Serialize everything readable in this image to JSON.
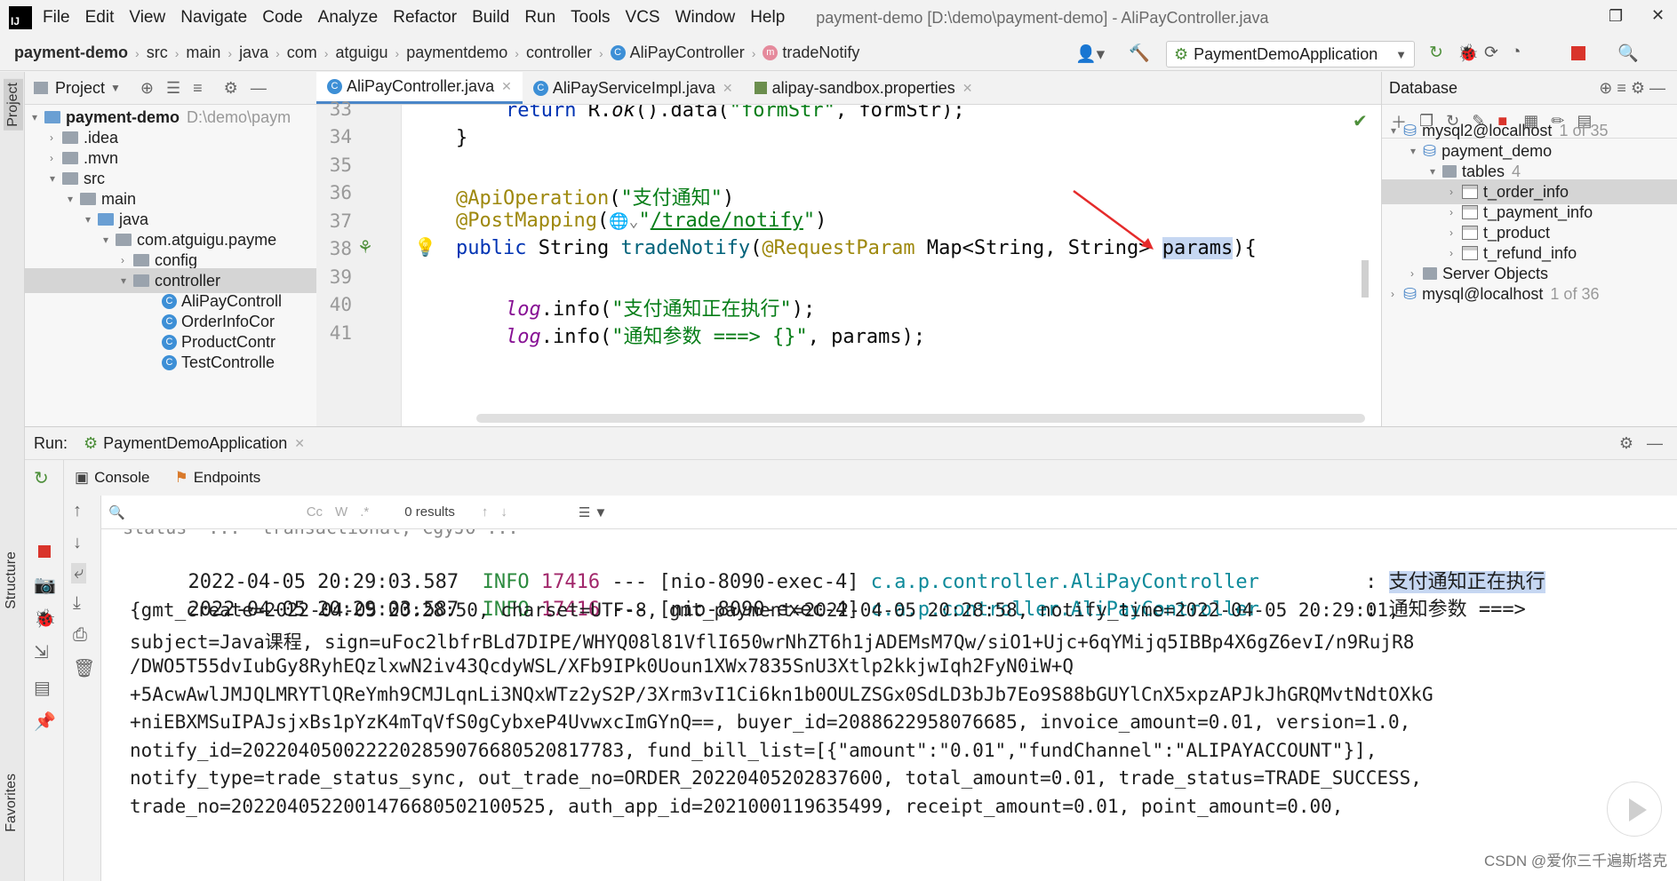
{
  "menubar": {
    "logo": "IJ",
    "items": [
      "File",
      "Edit",
      "View",
      "Navigate",
      "Code",
      "Analyze",
      "Refactor",
      "Build",
      "Run",
      "Tools",
      "VCS",
      "Window",
      "Help"
    ],
    "window_title": "payment-demo [D:\\demo\\payment-demo] - AliPayController.java"
  },
  "breadcrumb": {
    "items": [
      "payment-demo",
      "src",
      "main",
      "java",
      "com",
      "atguigu",
      "paymentdemo",
      "controller",
      "AliPayController",
      "tradeNotify"
    ]
  },
  "run_config": {
    "label": "PaymentDemoApplication"
  },
  "project_panel": {
    "title": "Project",
    "tree": [
      {
        "label": "payment-demo",
        "extra": "D:\\demo\\paym"
      },
      {
        "label": ".idea"
      },
      {
        "label": ".mvn"
      },
      {
        "label": "src"
      },
      {
        "label": "main"
      },
      {
        "label": "java"
      },
      {
        "label": "com.atguigu.payme"
      },
      {
        "label": "config"
      },
      {
        "label": "controller"
      },
      {
        "label": "AliPayControll"
      },
      {
        "label": "OrderInfoCor"
      },
      {
        "label": "ProductContr"
      },
      {
        "label": "TestControlle"
      }
    ]
  },
  "editor": {
    "tabs": [
      "AliPayController.java",
      "AliPayServiceImpl.java",
      "alipay-sandbox.properties"
    ],
    "line_numbers": [
      "33",
      "34",
      "35",
      "36",
      "37",
      "38",
      "39",
      "40",
      "41"
    ],
    "code": {
      "l33_kw": "return",
      "l33_a": " R.",
      "l33_ok": "ok",
      "l33_b": "().data(",
      "l33_s": "\"formStr\"",
      "l33_c": ", formStr);",
      "l34": "}",
      "l36_an": "@ApiOperation",
      "l36_a": "(",
      "l36_s": "\"支付通知\"",
      "l36_b": ")",
      "l37_an": "@PostMapping",
      "l37_a": "(",
      "l37_s1": "\"",
      "l37_url": "/trade/notify",
      "l37_s2": "\"",
      "l37_b": ")",
      "l38_kw": "public",
      "l38_a": " String ",
      "l38_fn": "tradeNotify",
      "l38_b": "(",
      "l38_an": "@RequestParam",
      "l38_c": " Map<String, String> ",
      "l38_hl": "params",
      "l38_d": "){",
      "l40_lg": "log",
      "l40_a": ".info(",
      "l40_s": "\"支付通知正在执行\"",
      "l40_b": ");",
      "l41_lg": "log",
      "l41_a": ".info(",
      "l41_s": "\"通知参数 ===> {}\"",
      "l41_b": ", params);"
    }
  },
  "database_panel": {
    "title": "Database",
    "tree": [
      {
        "label": "mysql2@localhost",
        "extra": "1 of 35"
      },
      {
        "label": "payment_demo"
      },
      {
        "label": "tables",
        "extra": "4"
      },
      {
        "label": "t_order_info"
      },
      {
        "label": "t_payment_info"
      },
      {
        "label": "t_product"
      },
      {
        "label": "t_refund_info"
      },
      {
        "label": "Server Objects"
      },
      {
        "label": "mysql@localhost",
        "extra": "1 of 36"
      }
    ]
  },
  "run_panel": {
    "label": "Run:",
    "config": "PaymentDemoApplication",
    "tabs": [
      "Console",
      "Endpoints"
    ],
    "search_results": "0 results",
    "search_opts": [
      "Cc",
      "W",
      ".*"
    ]
  },
  "console": {
    "line0": "  status  ...  transactional, CgyJO ...",
    "log1": {
      "time": "2022-04-05 20:29:03.587",
      "level": "INFO",
      "pid": "17416",
      "sep": "---",
      "thread": "[nio-8090-exec-4]",
      "cls": "c.a.p.controller.AliPayController",
      "colon": ":",
      "msg": "支付通知正在执行"
    },
    "log2": {
      "time": "2022-04-05 20:29:03.587",
      "level": "INFO",
      "pid": "17416",
      "sep": "---",
      "thread": "[nio-8090-exec-4]",
      "cls": "c.a.p.controller.AliPayController",
      "colon": ":",
      "msg": "通知参数 ===>"
    },
    "body": [
      "{gmt_create=2022-04-05 20:28:50, charset=UTF-8, gmt_payment=2022-04-05 20:28:58, notify_time=2022-04-05 20:29:01,",
      "subject=Java课程, sign=uFoc2lbfrBLd7DIPE/WHYQ08l81VflI650wrNhZT6h1jADEMsM7Qw/siO1+Ujc+6qYMijq5IBBp4X6gZ6evI/n9RujR8",
      "/DWO5T55dvIubGy8RyhEQzlxwN2iv43QcdyWSL/XFb9IPk0Uoun1XWx7835SnU3Xtlp2kkjwIqh2FyN0iW+Q",
      "+5AcwAwlJMJQLMRYTlQReYmh9CMJLqnLi3NQxWTz2yS2P/3Xrm3vI1Ci6kn1b0OULZSGx0SdLD3bJb7Eo9S88bGUYlCnX5xpzAPJkJhGRQMvtNdtOXkG",
      "+niEBXMSuIPAJsjxBs1pYzK4mTqVfS0gCybxeP4UvwxcImGYnQ==, buyer_id=2088622958076685, invoice_amount=0.01, version=1.0,",
      "notify_id=2022040500222202859076680520817783, fund_bill_list=[{\"amount\":\"0.01\",\"fundChannel\":\"ALIPAYACCOUNT\"}],",
      "notify_type=trade_status_sync, out_trade_no=ORDER_20220405202837600, total_amount=0.01, trade_status=TRADE_SUCCESS,",
      "trade_no=2022040522001476680502100525, auth_app_id=2021000119635499, receipt_amount=0.01, point_amount=0.00,"
    ]
  },
  "side_labels": {
    "project": "Project",
    "structure": "Structure",
    "favorites": "Favorites"
  },
  "watermark": "CSDN @爱你三千遍斯塔克",
  "colors": {
    "accent": "#4a86c8",
    "selection": "#c6d7f2",
    "info_green": "#2b8a3e",
    "class_teal": "#0d8a9a"
  }
}
